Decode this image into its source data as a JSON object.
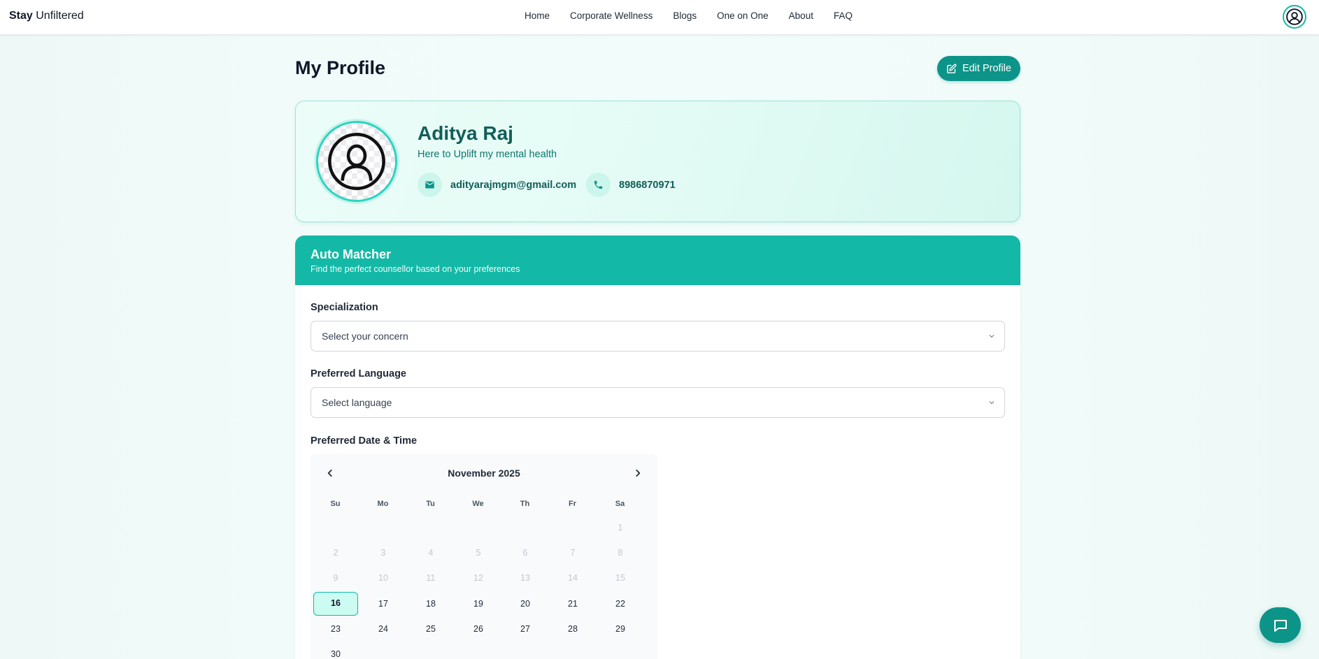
{
  "navbar": {
    "brand_bold": "Stay",
    "brand_light": "Unfiltered",
    "links": [
      "Home",
      "Corporate Wellness",
      "Blogs",
      "One on One",
      "About",
      "FAQ"
    ],
    "user_icon": "user-circle-icon"
  },
  "header": {
    "title": "My Profile",
    "edit_label": "Edit Profile",
    "edit_icon": "edit-icon"
  },
  "profile": {
    "name": "Aditya Raj",
    "tagline": "Here to Uplift my mental health",
    "email": "adityarajmgm@gmail.com",
    "phone": "8986870971",
    "email_icon": "envelope-icon",
    "phone_icon": "phone-icon"
  },
  "matcher": {
    "title": "Auto Matcher",
    "subtitle": "Find the perfect counsellor based on your preferences",
    "specialization_label": "Specialization",
    "specialization_value": "Select your concern",
    "language_label": "Preferred Language",
    "language_value": "Select language",
    "datetime_label": "Preferred Date & Time"
  },
  "calendar": {
    "month": "November 2025",
    "weekdays": [
      "Su",
      "Mo",
      "Tu",
      "We",
      "Th",
      "Fr",
      "Sa"
    ],
    "first_weekday_index": 6,
    "days_in_month": 30,
    "disabled_through": 15,
    "selected_day": 16
  },
  "colors": {
    "accent": "#14b8a6",
    "accent_dark": "#0d9488",
    "name_color": "#115e59"
  },
  "chat": {
    "icon": "chat-bubble-icon"
  }
}
